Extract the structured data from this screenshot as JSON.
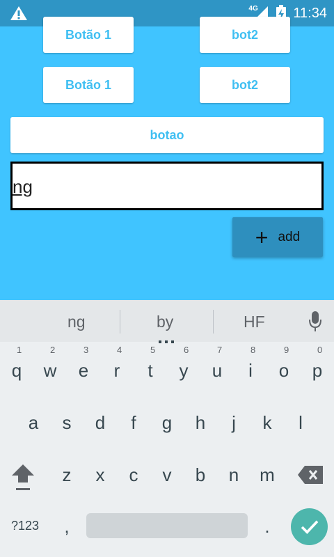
{
  "status": {
    "network": "4G",
    "time": "11:34"
  },
  "buttons": {
    "r1_left": "Botão 1",
    "r1_right": "bot2",
    "r2_left": "Botão 1",
    "r2_right": "bot2",
    "wide": "botao"
  },
  "input": {
    "value": "ng"
  },
  "add_button": {
    "label": "add",
    "icon": "plus-icon"
  },
  "keyboard": {
    "suggestions": [
      "ng",
      "by",
      "HF"
    ],
    "row1": [
      "q",
      "w",
      "e",
      "r",
      "t",
      "y",
      "u",
      "i",
      "o",
      "p"
    ],
    "row1_nums": [
      "1",
      "2",
      "3",
      "4",
      "5",
      "6",
      "7",
      "8",
      "9",
      "0"
    ],
    "row2": [
      "a",
      "s",
      "d",
      "f",
      "g",
      "h",
      "j",
      "k",
      "l"
    ],
    "row3": [
      "z",
      "x",
      "c",
      "v",
      "b",
      "n",
      "m"
    ],
    "symbols": "?123",
    "comma": ",",
    "period": "."
  },
  "colors": {
    "app_bg": "#40C4FF",
    "statusbar": "#2F95C5",
    "accent_text": "#40BFF2",
    "add_bg": "#2E8FBE",
    "enter": "#4DB6AC"
  }
}
